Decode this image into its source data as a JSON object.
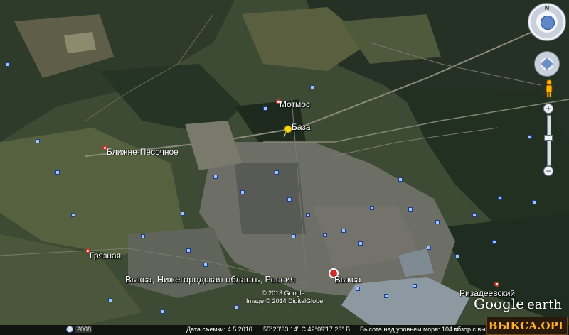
{
  "map": {
    "places": {
      "motmos": "Мотмос",
      "baza": "База",
      "blizhne": "Ближне-Песочное",
      "gryaznaya": "Грязная",
      "vyksa_full": "Выкса, Нижегородская область, Россия",
      "vyksa": "Выкса",
      "rizadeevsky": "Ризадеевский"
    },
    "credits": {
      "copyright": "© 2013 Google",
      "imagery": "Image © 2014 DigitalGlobe"
    },
    "logo": {
      "google": "Google",
      "earth": "earth"
    }
  },
  "nav": {
    "north_label": "N",
    "zoom_in": "+",
    "zoom_out": "−",
    "icons": [
      "compass-icon",
      "pan-icon",
      "pegman-icon",
      "zoom-slider-icon"
    ]
  },
  "status": {
    "year": "2008",
    "date": "Дата съемки: 4.5.2010",
    "coords": "55°20'33.14\" С   42°09'17.23\" В",
    "elevation": "Высота над уровнем моря:   104 м",
    "eye_alt": "обзор с высоты 11.83 км"
  },
  "watermark": "ВЫКСА.ОРГ",
  "colors": {
    "forest": "#243224",
    "field": "#4a5a3b",
    "city": "#6c6d66",
    "water": "#8e9aa3",
    "pin": "#f3d61a"
  }
}
